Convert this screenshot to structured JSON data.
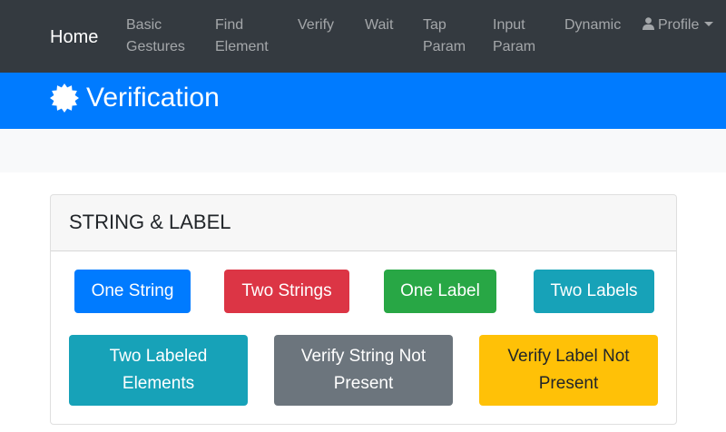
{
  "navbar": {
    "brand": "Home",
    "links": [
      {
        "line1": "Basic",
        "line2": "Gestures"
      },
      {
        "line1": "Find",
        "line2": "Element"
      },
      {
        "line1": "Verify",
        "line2": ""
      },
      {
        "line1": "Wait",
        "line2": ""
      },
      {
        "line1": "Tap",
        "line2": "Param"
      },
      {
        "line1": "Input",
        "line2": "Param"
      },
      {
        "line1": "Dynamic",
        "line2": ""
      }
    ],
    "profile": "Profile",
    "profile_icon": "user-icon",
    "background": "#343a40"
  },
  "header": {
    "icon": "badge-icon",
    "title": "Verification",
    "background": "#007bff"
  },
  "card": {
    "title": "STRING & LABEL",
    "buttons": [
      {
        "label": "One String",
        "color": "#007bff"
      },
      {
        "label": "Two Strings",
        "color": "#dc3545"
      },
      {
        "label": "One Label",
        "color": "#28a745"
      },
      {
        "label": "Two Labels",
        "color": "#17a2b8"
      },
      {
        "label": "Two Labeled Elements",
        "color": "#17a2b8"
      },
      {
        "label": "Verify String Not Present",
        "color": "#6c757d"
      },
      {
        "label": "Verify Label Not Present",
        "color": "#ffc107"
      }
    ]
  }
}
